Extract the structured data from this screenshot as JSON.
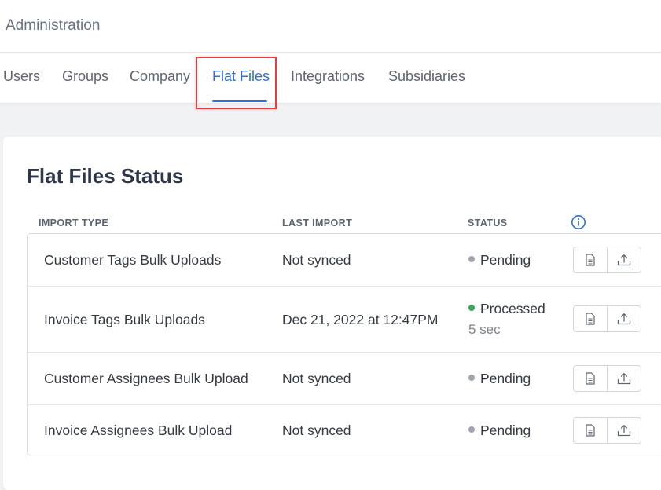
{
  "header": {
    "title": "Administration"
  },
  "tabs": [
    {
      "label": "Users",
      "active": false
    },
    {
      "label": "Groups",
      "active": false
    },
    {
      "label": "Company",
      "active": false
    },
    {
      "label": "Flat Files",
      "active": true
    },
    {
      "label": "Integrations",
      "active": false
    },
    {
      "label": "Subsidiaries",
      "active": false
    }
  ],
  "colors": {
    "accent": "#2f6fd8",
    "highlight": "#e04040",
    "pending_dot": "#a0a5ad",
    "processed_dot": "#3ba55c"
  },
  "card": {
    "title": "Flat Files Status",
    "columns": {
      "import_type": "IMPORT TYPE",
      "last_import": "LAST IMPORT",
      "status": "STATUS"
    },
    "info_icon": "info-icon",
    "rows": [
      {
        "import_type": "Customer Tags Bulk Uploads",
        "last_import": "Not synced",
        "status": "Pending",
        "duration": ""
      },
      {
        "import_type": "Invoice Tags Bulk Uploads",
        "last_import": "Dec 21, 2022 at 12:47PM",
        "status": "Processed",
        "duration": "5 sec"
      },
      {
        "import_type": "Customer Assignees Bulk Upload",
        "last_import": "Not synced",
        "status": "Pending",
        "duration": ""
      },
      {
        "import_type": "Invoice Assignees Bulk Upload",
        "last_import": "Not synced",
        "status": "Pending",
        "duration": ""
      }
    ],
    "row_actions": [
      "document-icon",
      "upload-icon"
    ]
  }
}
